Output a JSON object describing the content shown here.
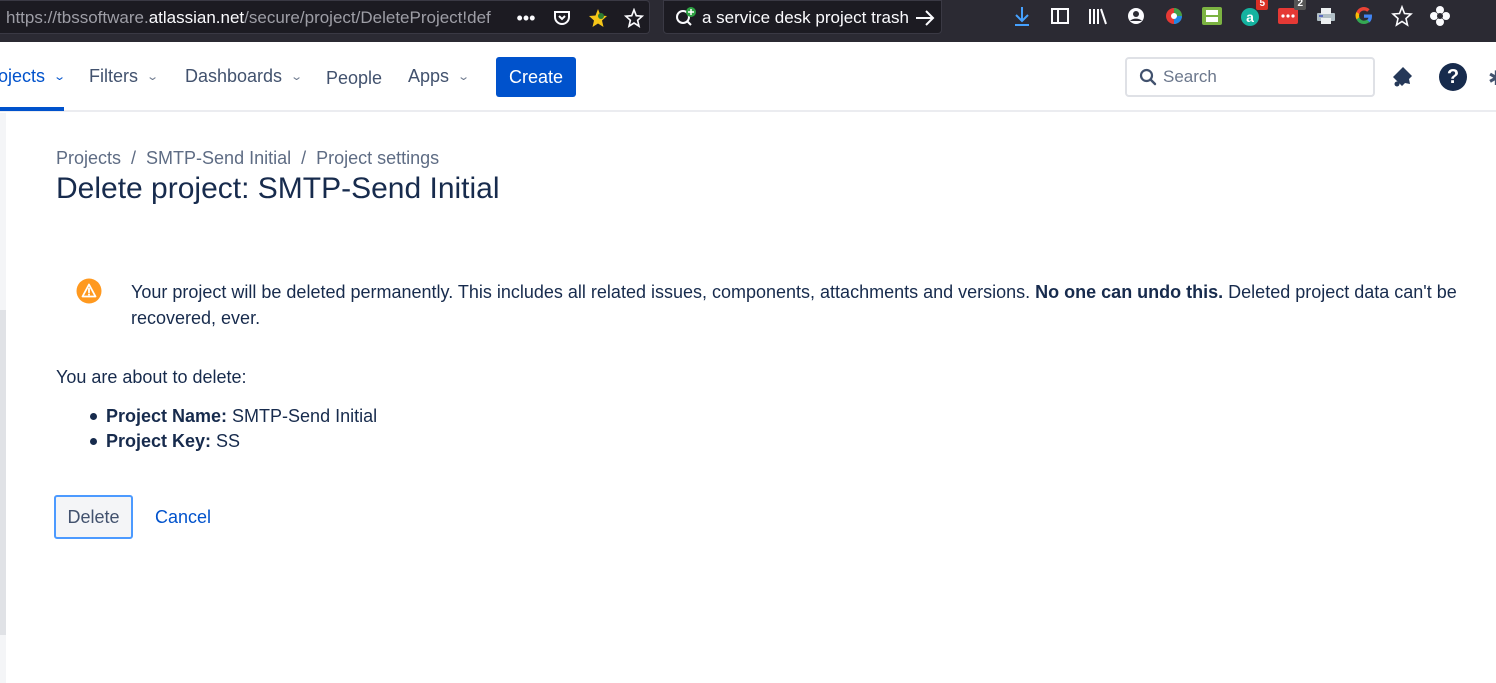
{
  "browser": {
    "url_prefix": "https://tbssoftware.",
    "url_domain": "atlassian.net",
    "url_suffix": "/secure/project/DeleteProject!def",
    "search_text": "a service desk project trash",
    "badges": {
      "extension_a": "5",
      "extension_dots": "2"
    }
  },
  "nav": {
    "projects": "ojects",
    "filters": "Filters",
    "dashboards": "Dashboards",
    "people": "People",
    "apps": "Apps",
    "create": "Create",
    "search_placeholder": "Search"
  },
  "breadcrumb": {
    "projects": "Projects",
    "project": "SMTP-Send Initial",
    "settings": "Project settings",
    "separator": "/"
  },
  "page_title": "Delete project: SMTP-Send Initial",
  "warning": {
    "text_before": "Your project will be deleted permanently. This includes all related issues, components, attachments and versions. ",
    "bold": "No one can undo this.",
    "text_after": " Deleted project data can't be recovered, ever."
  },
  "about_label": "You are about to delete:",
  "details": {
    "name_label": "Project Name:",
    "name_value": " SMTP-Send Initial",
    "key_label": "Project Key:",
    "key_value": " SS"
  },
  "actions": {
    "delete": "Delete",
    "cancel": "Cancel"
  },
  "colors": {
    "primary": "#0052cc",
    "warning": "#ff991f",
    "text": "#172b4d"
  }
}
